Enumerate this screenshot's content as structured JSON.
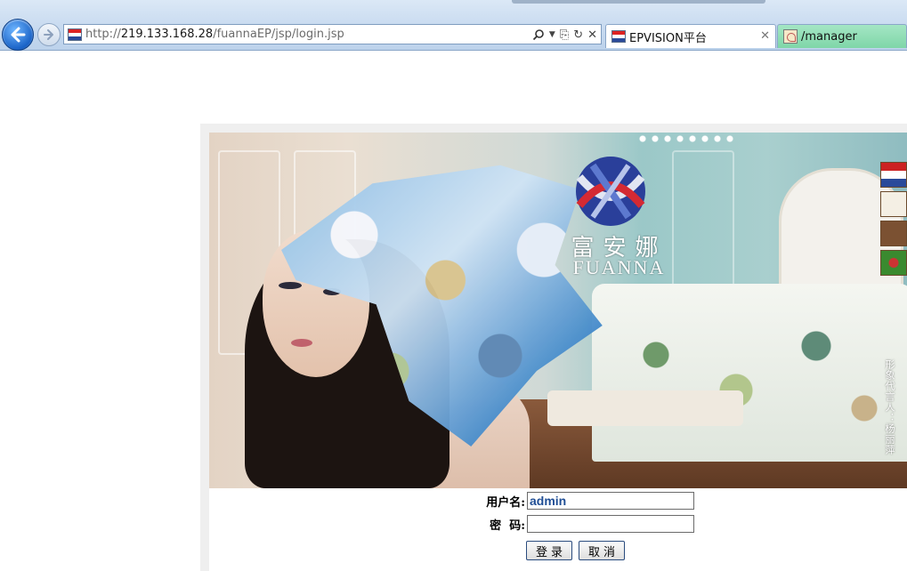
{
  "browser": {
    "address": {
      "scheme": "http://",
      "host": "219.133.168.28",
      "path": "/fuannaEP/jsp/login.jsp"
    },
    "tabs": [
      {
        "label": "EPVISION平台",
        "active": true
      },
      {
        "label": "/manager",
        "active": false
      }
    ]
  },
  "banner": {
    "logo_cn": "富安娜",
    "logo_en": "FUANNA",
    "spokesperson": "形象代言人：杨丽萍"
  },
  "login": {
    "username_label": "用户名:",
    "username_value": "admin",
    "password_label": "密  码:",
    "password_value": "",
    "login_button": "登录",
    "cancel_button": "取消"
  },
  "colors": {
    "accent_blue": "#1a63c7",
    "input_text": "#1f4e95",
    "tab_inactive": "#8fdcb2"
  }
}
